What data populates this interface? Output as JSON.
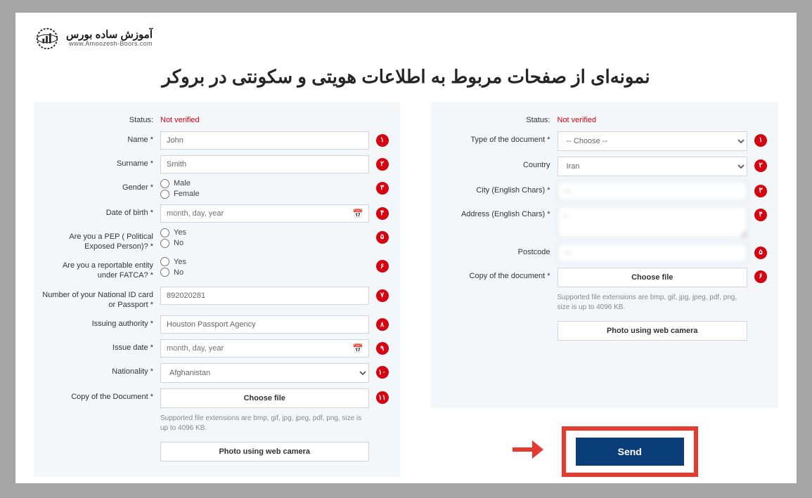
{
  "logo": {
    "name_fa": "آموزش ساده بورس",
    "url": "www.Amoozesh-Boors.com"
  },
  "headline": "نمونه‌ای از صفحات مربوط به اطلاعات هویتی و سکونتی در بروکر",
  "left": {
    "status_label": "Status:",
    "status_value": "Not verified",
    "name_label": "Name *",
    "name_value": "John",
    "surname_label": "Surname *",
    "surname_value": "Smith",
    "gender_label": "Gender *",
    "gender_male": "Male",
    "gender_female": "Female",
    "dob_label": "Date of birth *",
    "dob_placeholder": "month, day, year",
    "pep_label": "Are you a PEP ( Political Exposed Person)? *",
    "yes": "Yes",
    "no": "No",
    "fatca_label": "Are you a reportable entity under FATCA? *",
    "idnum_label": "Number of your National ID card or Passport *",
    "idnum_value": "892020281",
    "issauth_label": "Issuing authority *",
    "issauth_value": "Houston Passport Agency",
    "issdate_label": "Issue date *",
    "issdate_placeholder": "month, day, year",
    "nationality_label": "Nationality *",
    "nationality_value": "Afghanistan",
    "copy_label": "Copy of the Document *",
    "choose_file": "Choose file",
    "hint": "Supported file extensions are bmp, gif, jpg, jpeg, pdf, png, size is up to 4096 KB.",
    "webcam": "Photo using web camera",
    "markers": [
      "۱",
      "۲",
      "۳",
      "۴",
      "۵",
      "۶",
      "۷",
      "۸",
      "۹",
      "۱۰",
      "۱۱"
    ]
  },
  "right": {
    "status_label": "Status:",
    "status_value": "Not verified",
    "doctype_label": "Type of the document *",
    "doctype_value": "-- Choose --",
    "country_label": "Country",
    "country_value": "Iran",
    "city_label": "City (English Chars) *",
    "city_value": "—",
    "address_label": "Address (English Chars) *",
    "address_value": "—",
    "postcode_label": "Postcode",
    "postcode_value": "—",
    "copy_label": "Copy of the document *",
    "choose_file": "Choose file",
    "hint": "Supported file extensions are bmp, gif, jpg, jpeg, pdf, png, size is up to 4096 KB.",
    "webcam": "Photo using web camera",
    "markers": [
      "۱",
      "۲",
      "۳",
      "۴",
      "۵",
      "۶"
    ]
  },
  "send": "Send"
}
